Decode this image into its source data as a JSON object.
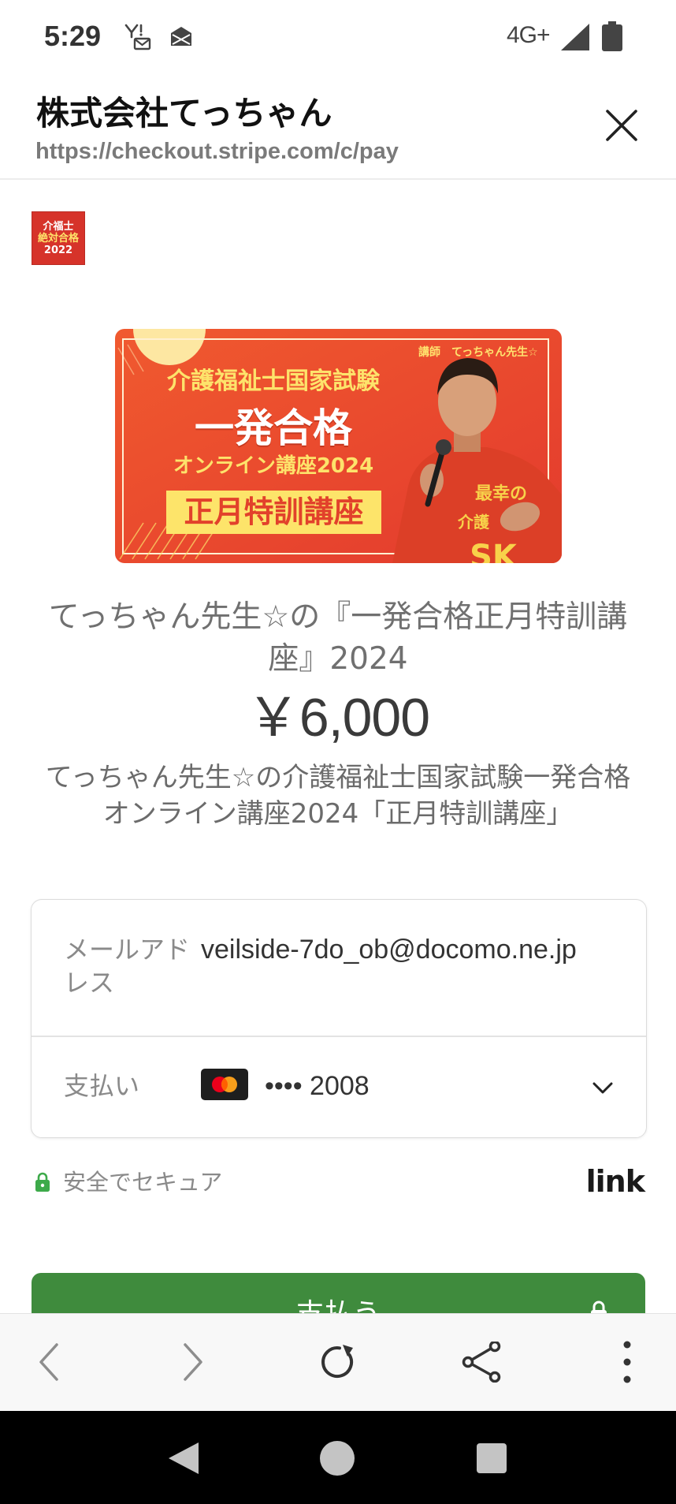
{
  "status_bar": {
    "time": "5:29",
    "network": "4G+",
    "icons": [
      "yahoo-mail-icon",
      "mail-notification-icon",
      "signal-icon",
      "battery-icon"
    ]
  },
  "header": {
    "title": "株式会社てっちゃん",
    "url": "https://checkout.stripe.com/c/pay",
    "close_icon": "close-icon"
  },
  "merchant_logo": {
    "lines": [
      "介福士",
      "絶対合格",
      "2022"
    ]
  },
  "banner": {
    "instructor": "講師　てっちゃん先生☆",
    "exam": "介護福祉士国家試験",
    "headline": "一発合格",
    "course": "オンライン講座2024",
    "badge": "正月特訓講座",
    "shirt_text": [
      "最幸の",
      "介護",
      "SK"
    ]
  },
  "product": {
    "name": "てっちゃん先生☆の『一発合格正月特訓講座』2024",
    "price": "￥6,000",
    "description": "てっちゃん先生☆の介護福祉士国家試験一発合格オンライン講座2024「正月特訓講座」"
  },
  "form": {
    "email": {
      "label": "メールアドレス",
      "value": "veilside-7do_ob@docomo.ne.jp"
    },
    "payment": {
      "label": "支払い",
      "card_brand_icon": "mastercard-icon",
      "card_number": "•••• 2008",
      "dropdown_icon": "chevron-down-icon"
    }
  },
  "security": {
    "icon": "lock-icon",
    "text": "安全でセキュア",
    "link_logo": "link"
  },
  "pay_button": {
    "label": "支払う",
    "icon": "lock-icon"
  },
  "browser_toolbar": {
    "icons": [
      "back-icon",
      "forward-icon",
      "reload-icon",
      "share-icon",
      "more-icon"
    ]
  },
  "system_nav": {
    "icons": [
      "nav-back-icon",
      "nav-home-icon",
      "nav-recents-icon"
    ]
  },
  "colors": {
    "pay_button": "#3f8b3d",
    "secure_lock": "#3daa4a",
    "banner_background": "#e9492c",
    "banner_accent": "#fde46a",
    "text_primary": "#222222",
    "text_secondary": "#707070"
  }
}
